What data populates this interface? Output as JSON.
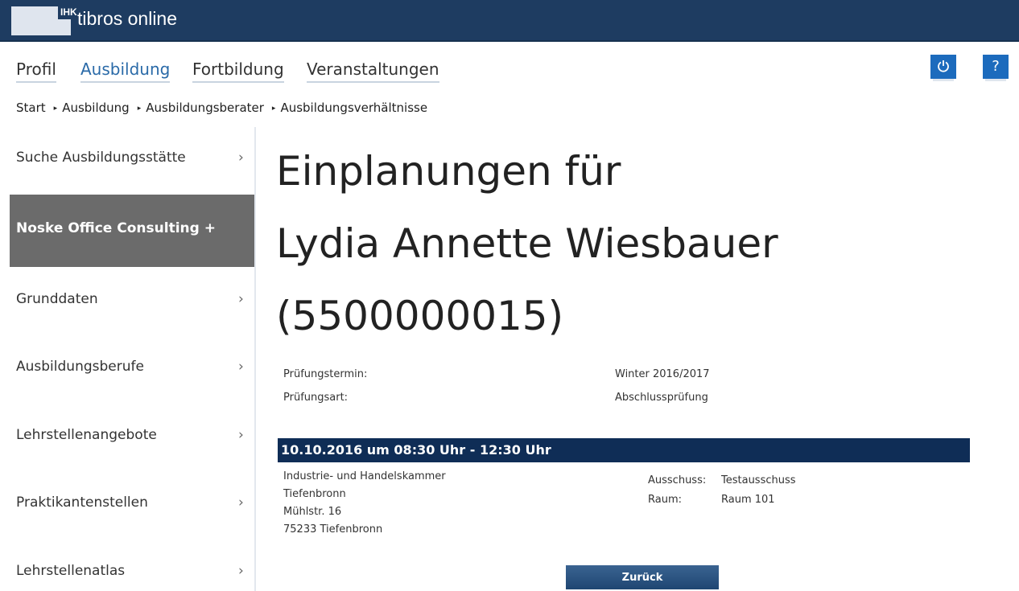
{
  "header": {
    "logo_text": "IHK",
    "app_title": "tibros online"
  },
  "nav": [
    "Profil",
    "Ausbildung",
    "Fortbildung",
    "Veranstaltungen"
  ],
  "nav_active": "Ausbildung",
  "icons": {
    "power": "power-icon",
    "help_label": "?"
  },
  "breadcrumb": [
    "Start",
    "Ausbildung",
    "Ausbildungsberater",
    "Ausbildungsverhältnisse"
  ],
  "breadcrumb_separator": "▸",
  "sidebar": [
    {
      "label": "Suche Ausbildungsstätte",
      "chevron": "›"
    },
    {
      "label": "Noske Office Consulting +",
      "chevron": ""
    },
    {
      "label": "Grunddaten",
      "chevron": "›"
    },
    {
      "label": "Ausbildungsberufe",
      "chevron": "›"
    },
    {
      "label": "Lehrstellenangebote",
      "chevron": "›"
    },
    {
      "label": "Praktikantenstellen",
      "chevron": "›"
    },
    {
      "label": "Lehrstellenatlas",
      "chevron": "›"
    }
  ],
  "title": {
    "line1": "Einplanungen für",
    "line2": "Lydia Annette Wiesbauer",
    "line3": "(5500000015)"
  },
  "info": [
    {
      "label": "Prüfungstermin:",
      "value": "Winter 2016/2017"
    },
    {
      "label": "Prüfungsart:",
      "value": "Abschlussprüfung"
    }
  ],
  "termin": {
    "heading": "10.10.2016 um 08:30 Uhr - 12:30 Uhr",
    "address": [
      "Industrie- und Handelskammer",
      "Tiefenbronn",
      "Mühlstr. 16",
      "75233 Tiefenbronn"
    ],
    "ausschuss_label": "Ausschuss:",
    "ausschuss_value": "Testausschuss",
    "raum_label": "Raum:",
    "raum_value": "Raum 101"
  },
  "back_button": "Zurück",
  "colors": {
    "header": "#1e3c61",
    "accent": "#1c6bbd",
    "termin_bar": "#0f2d56",
    "sidebar_active": "#6b6b6b"
  }
}
